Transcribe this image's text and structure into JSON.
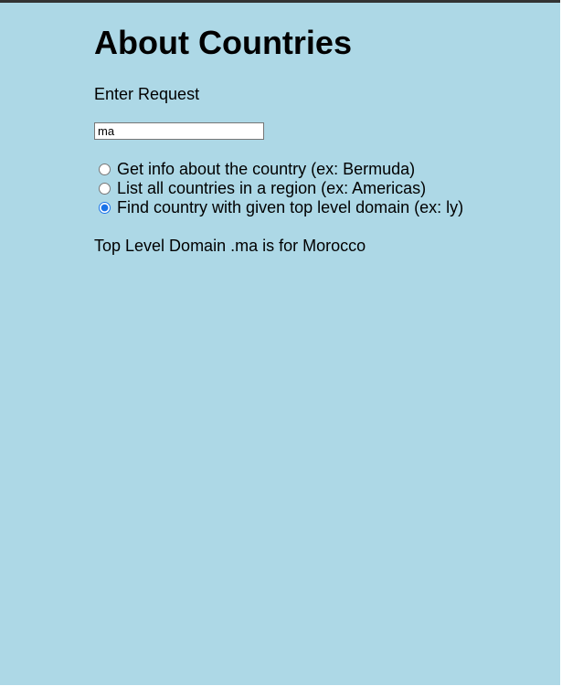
{
  "page": {
    "title": "About Countries",
    "prompt_label": "Enter Request",
    "input_value": "ma"
  },
  "options": [
    {
      "label": "Get info about the country (ex: Bermuda)",
      "checked": false
    },
    {
      "label": "List all countries in a region (ex: Americas)",
      "checked": false
    },
    {
      "label": "Find country with given top level domain (ex: ly)",
      "checked": true
    }
  ],
  "result": {
    "text": "Top Level Domain .ma is for Morocco"
  },
  "colors": {
    "background": "#add8e6",
    "radio_accent": "#1a73e8"
  }
}
